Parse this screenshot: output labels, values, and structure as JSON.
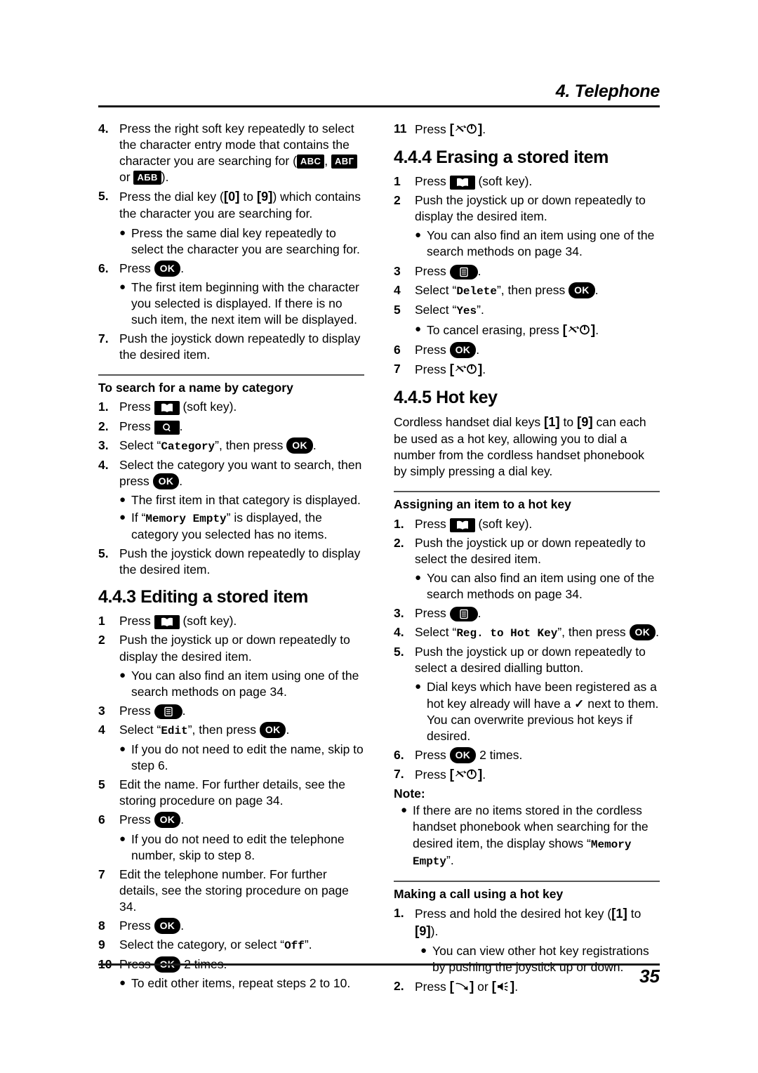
{
  "header": {
    "title": "4. Telephone"
  },
  "footer": {
    "page_number": "35"
  },
  "icons": {
    "phonebook": "phonebook-book-icon",
    "search": "magnifier-icon",
    "menu": "menu-list-icon",
    "off": "off-power-icon",
    "talk": "talk-handset-icon",
    "speaker": "speakerphone-icon",
    "ok": "OK"
  },
  "chips": {
    "abc_latin": "ABC",
    "abc_cyrillic_upper": "АВГ",
    "abc_cyrillic": "АБВ"
  },
  "left_column": {
    "search_by_character_steps": [
      {
        "num": "4.",
        "text_parts": [
          "Press the right soft key repeatedly to select the character entry mode that contains the character you are searching for (",
          ", ",
          " or ",
          ")."
        ]
      },
      {
        "num": "5.",
        "pre": "Press the dial key (",
        "key_from": "0",
        "mid": " to ",
        "key_to": "9",
        "post": ") which contains the character you are searching for.",
        "bullets": [
          "Press the same dial key repeatedly to select the character you are searching for."
        ]
      },
      {
        "num": "6.",
        "pre": "Press ",
        "post": ".",
        "bullets": [
          "The first item beginning with the character you selected is displayed. If there is no such item, the next item will be displayed."
        ]
      },
      {
        "num": "7.",
        "text": "Push the joystick down repeatedly to display the desired item."
      }
    ],
    "category_section": {
      "heading": "To search for a name by category",
      "steps": [
        {
          "num": "1.",
          "pre": "Press ",
          "post": " (soft key)."
        },
        {
          "num": "2.",
          "pre": "Press ",
          "post": "."
        },
        {
          "num": "3.",
          "pre": "Select “",
          "display": "Category",
          "mid": "”, then press ",
          "post": "."
        },
        {
          "num": "4.",
          "pre": "Select the category you want to search, then press ",
          "post": ".",
          "bullets": [
            {
              "text": "The first item in that category is displayed."
            },
            {
              "pre": "If “",
              "display": "Memory Empty",
              "post": "” is displayed, the category you selected has no items."
            }
          ]
        },
        {
          "num": "5.",
          "text": "Push the joystick down repeatedly to display the desired item."
        }
      ]
    },
    "editing_section": {
      "heading": "4.4.3 Editing a stored item",
      "steps": [
        {
          "num": "1",
          "pre": "Press ",
          "post": " (soft key)."
        },
        {
          "num": "2",
          "text": "Push the joystick up or down repeatedly to display the desired item.",
          "bullets": [
            "You can also find an item using one of the search methods on page 34."
          ]
        },
        {
          "num": "3",
          "pre": "Press ",
          "post": "."
        },
        {
          "num": "4",
          "pre": "Select “",
          "display": "Edit",
          "mid": "”, then press ",
          "post": ".",
          "bullets": [
            "If you do not need to edit the name, skip to step 6."
          ]
        },
        {
          "num": "5",
          "text": "Edit the name. For further details, see the storing procedure on page 34."
        },
        {
          "num": "6",
          "pre": "Press ",
          "post": ".",
          "bullets": [
            "If you do not need to edit the telephone number, skip to step 8."
          ]
        },
        {
          "num": "7",
          "text": "Edit the telephone number. For further details, see the storing procedure on page 34."
        },
        {
          "num": "8",
          "pre": "Press ",
          "post": "."
        },
        {
          "num": "9",
          "pre": "Select the category, or select “",
          "display": "Off",
          "post": "”."
        },
        {
          "num": "10",
          "pre": "Press ",
          "post": " 2 times.",
          "bullets": [
            "To edit other items, repeat steps 2 to 10."
          ]
        }
      ]
    }
  },
  "right_column": {
    "step11": {
      "num": "11",
      "pre": "Press ",
      "post": "."
    },
    "erasing_section": {
      "heading": "4.4.4 Erasing a stored item",
      "steps": [
        {
          "num": "1",
          "pre": "Press ",
          "post": " (soft key)."
        },
        {
          "num": "2",
          "text": "Push the joystick up or down repeatedly to display the desired item.",
          "bullets": [
            "You can also find an item using one of the search methods on page 34."
          ]
        },
        {
          "num": "3",
          "pre": "Press ",
          "post": "."
        },
        {
          "num": "4",
          "pre": "Select “",
          "display": "Delete",
          "mid": "”, then press ",
          "post": "."
        },
        {
          "num": "5",
          "pre": "Select “",
          "display": "Yes",
          "post": "”.",
          "bullets": [
            {
              "pre": "To cancel erasing, press ",
              "post": "."
            }
          ]
        },
        {
          "num": "6",
          "pre": "Press ",
          "post": "."
        },
        {
          "num": "7",
          "pre": "Press ",
          "post": "."
        }
      ]
    },
    "hotkey_section": {
      "heading": "4.4.5 Hot key",
      "intro_pre": "Cordless handset dial keys ",
      "intro_key_from": "1",
      "intro_mid": " to ",
      "intro_key_to": "9",
      "intro_post": " can each be used as a hot key, allowing you to dial a number from the cordless handset phonebook by simply pressing a dial key.",
      "assign_heading": "Assigning an item to a hot key",
      "assign_steps": [
        {
          "num": "1.",
          "pre": "Press ",
          "post": " (soft key)."
        },
        {
          "num": "2.",
          "text": "Push the joystick up or down repeatedly to select the desired item.",
          "bullets": [
            "You can also find an item using one of the search methods on page 34."
          ]
        },
        {
          "num": "3.",
          "pre": "Press ",
          "post": "."
        },
        {
          "num": "4.",
          "pre": "Select “",
          "display": "Reg. to Hot Key",
          "mid": "”, then press ",
          "post": "."
        },
        {
          "num": "5.",
          "text": "Push the joystick up or down repeatedly to select a desired dialling button.",
          "bullets_rich": [
            {
              "pre": "Dial keys which have been registered as a hot key already will have a ",
              "check": "✓",
              "post": " next to them. You can overwrite previous hot keys if desired."
            }
          ]
        },
        {
          "num": "6.",
          "pre": "Press ",
          "post": " 2 times."
        },
        {
          "num": "7.",
          "pre": "Press ",
          "post": "."
        }
      ],
      "note_label": "Note:",
      "note_bullet": {
        "pre": "If there are no items stored in the cordless handset phonebook when searching for the desired item, the display shows “",
        "display": "Memory Empty",
        "post": "”."
      },
      "call_heading": "Making a call using a hot key",
      "call_steps": [
        {
          "num": "1.",
          "pre": "Press and hold the desired hot key (",
          "key_from": "1",
          "mid": " to ",
          "key_to": "9",
          "post": ").",
          "bullets": [
            "You can view other hot key registrations by pushing the joystick up or down."
          ]
        },
        {
          "num": "2.",
          "pre": "Press ",
          "mid": " or ",
          "post": "."
        }
      ]
    }
  }
}
